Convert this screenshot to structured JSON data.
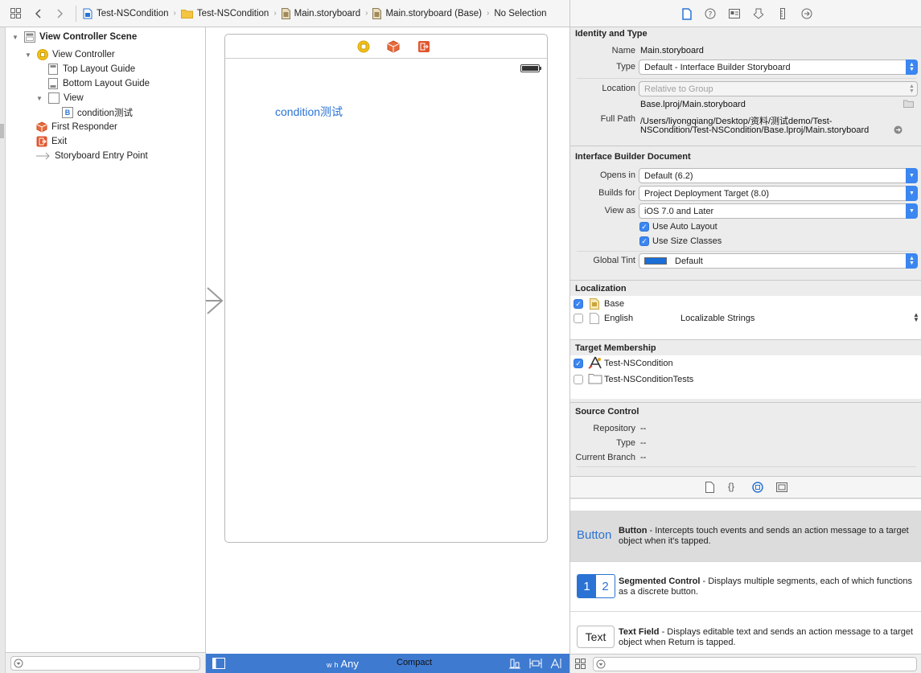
{
  "breadcrumbs": [
    "Test-NSCondition",
    "Test-NSCondition",
    "Main.storyboard",
    "Main.storyboard (Base)",
    "No Selection"
  ],
  "outline": {
    "scene": "View Controller Scene",
    "view_controller": "View Controller",
    "top_layout_guide": "Top Layout Guide",
    "bottom_layout_guide": "Bottom Layout Guide",
    "view": "View",
    "button": "condition测试",
    "first_responder": "First Responder",
    "exit": "Exit",
    "entry_point": "Storyboard Entry Point",
    "entry_badge": "B"
  },
  "canvas": {
    "button_title": "condition测试",
    "size_w_prefix": "w",
    "size_w": "Compact",
    "size_h_prefix": "h",
    "size_h": "Any"
  },
  "identity": {
    "header": "Identity and Type",
    "name_label": "Name",
    "name_value": "Main.storyboard",
    "type_label": "Type",
    "type_value": "Default - Interface Builder Storyboard",
    "location_label": "Location",
    "location_value": "Relative to Group",
    "location_path": "Base.lproj/Main.storyboard",
    "fullpath_label": "Full Path",
    "fullpath_line1": "/Users/liyongqiang/Desktop/资料/测试demo/Test-",
    "fullpath_line2": "NSCondition/Test-NSCondition/Base.lproj/Main.storyboard"
  },
  "ibdoc": {
    "header": "Interface Builder Document",
    "opens_label": "Opens in",
    "opens_value": "Default (6.2)",
    "builds_label": "Builds for",
    "builds_value": "Project Deployment Target (8.0)",
    "viewas_label": "View as",
    "viewas_value": "iOS 7.0 and Later",
    "auto_layout": "Use Auto Layout",
    "size_classes": "Use Size Classes",
    "tint_label": "Global Tint",
    "tint_value": "Default",
    "tint_color": "#1a6fd8"
  },
  "localization": {
    "header": "Localization",
    "base": "Base",
    "english": "English",
    "english_type": "Localizable Strings"
  },
  "target": {
    "header": "Target Membership",
    "app": "Test-NSCondition",
    "tests": "Test-NSConditionTests"
  },
  "source": {
    "header": "Source Control",
    "repo_label": "Repository",
    "repo_value": "--",
    "type_label": "Type",
    "type_value": "--",
    "branch_label": "Current Branch",
    "branch_value": "--"
  },
  "library": {
    "button_preview": "Button",
    "button_title": "Button",
    "button_desc": " - Intercepts touch events and sends an action message to a target object when it's tapped.",
    "seg_1": "1",
    "seg_2": "2",
    "seg_title": "Segmented Control",
    "seg_desc": " - Displays multiple segments, each of which functions as a discrete button.",
    "text_preview": "Text",
    "text_title": "Text Field",
    "text_desc": " - Displays editable text and sends an action message to a target object when Return is tapped."
  },
  "colors": {
    "accent": "#3b86f0",
    "canvas_bar": "#3e7ad0",
    "link_blue": "#2a73d4"
  }
}
